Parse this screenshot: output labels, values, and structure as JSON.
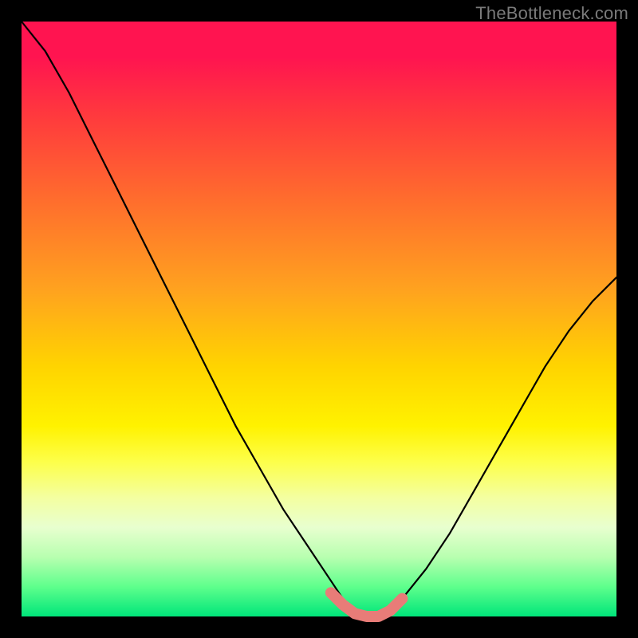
{
  "watermark": "TheBottleneck.com",
  "chart_data": {
    "type": "line",
    "title": "",
    "xlabel": "",
    "ylabel": "",
    "xlim": [
      0,
      100
    ],
    "ylim": [
      0,
      100
    ],
    "series": [
      {
        "name": "bottleneck-curve",
        "color": "#000000",
        "x": [
          0,
          4,
          8,
          12,
          16,
          20,
          24,
          28,
          32,
          36,
          40,
          44,
          48,
          52,
          54,
          56,
          58,
          60,
          62,
          64,
          68,
          72,
          76,
          80,
          84,
          88,
          92,
          96,
          100
        ],
        "y": [
          100,
          95,
          88,
          80,
          72,
          64,
          56,
          48,
          40,
          32,
          25,
          18,
          12,
          6,
          3,
          1,
          0,
          0,
          1,
          3,
          8,
          14,
          21,
          28,
          35,
          42,
          48,
          53,
          57
        ]
      },
      {
        "name": "optimal-flat-region",
        "color": "#e57373",
        "x": [
          52,
          54,
          56,
          58,
          60,
          62,
          64
        ],
        "y": [
          4,
          2,
          0.5,
          0,
          0,
          1,
          3
        ]
      }
    ],
    "notes": "V-shaped bottleneck curve over rainbow heat gradient; pink segment marks flat minimum around x≈56–62."
  }
}
